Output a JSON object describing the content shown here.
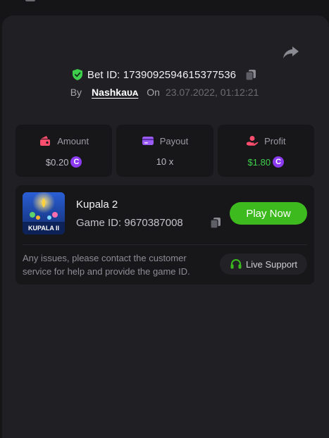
{
  "bet": {
    "id_text": "Bet ID: 1739092594615377536",
    "by_label": "By",
    "username": "Nashkaᴜᴀ",
    "on_label": "On",
    "datetime": "23.07.2022, 01:12:21"
  },
  "stats": {
    "amount": {
      "label": "Amount",
      "value": "$0.20",
      "icon": "bet-amount-icon",
      "color": "#ff4d6d"
    },
    "payout": {
      "label": "Payout",
      "value": "10 x",
      "icon": "wallet-icon",
      "color": "#9a5cf5"
    },
    "profit": {
      "label": "Profit",
      "value": "$1.80",
      "icon": "hand-coin-icon",
      "color": "#ff4d6d"
    }
  },
  "coin_symbol": "C",
  "game": {
    "name": "Kupala 2",
    "id_text": "Game ID: 9670387008",
    "thumb_title": "KUPALA II",
    "play_label": "Play Now"
  },
  "support": {
    "message": "Any issues, please contact the customer service for help and provide the game ID.",
    "button_label": "Live Support"
  },
  "colors": {
    "accent_green": "#3dbb1e",
    "profit_green": "#3ecf4c",
    "coin_purple": "#8c3bf2"
  }
}
